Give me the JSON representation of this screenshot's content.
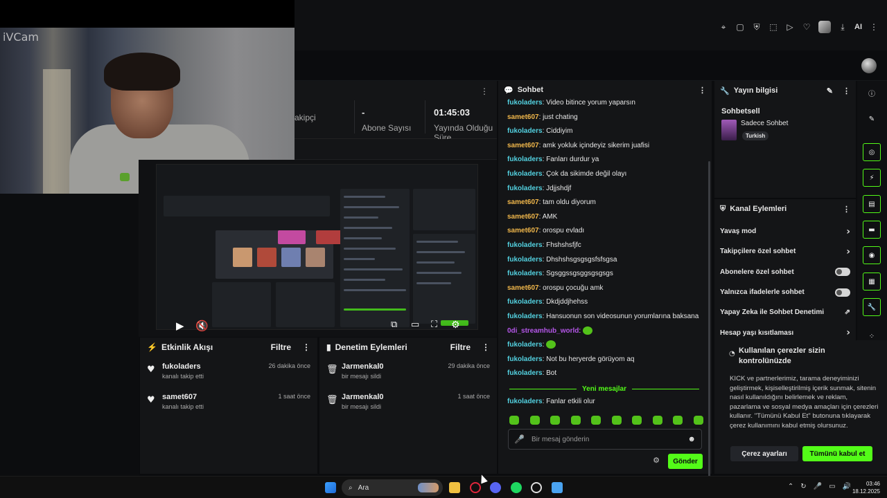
{
  "webcam": {
    "label": "iVCam"
  },
  "browser": {
    "ai_label": "AI"
  },
  "stats": {
    "items": [
      {
        "value": "",
        "label": "akipçi"
      },
      {
        "value": "-",
        "label": "Abone Sayısı"
      },
      {
        "value": "01:45:03",
        "label": "Yayında Olduğu Süre"
      }
    ]
  },
  "activity_feed": {
    "title": "Etkinlik Akışı",
    "filter": "Filtre",
    "items": [
      {
        "name": "fukoladers",
        "sub": "kanalı takip etti",
        "time": "26 dakika önce"
      },
      {
        "name": "samet607",
        "sub": "kanalı takip etti",
        "time": "1 saat önce"
      }
    ]
  },
  "moderation": {
    "title": "Denetim Eylemleri",
    "filter": "Filtre",
    "items": [
      {
        "name": "Jarmenkal0",
        "sub": "bir mesajı sildi",
        "time": "29 dakika önce"
      },
      {
        "name": "Jarmenkal0",
        "sub": "bir mesajı sildi",
        "time": "1 saat önce"
      }
    ]
  },
  "chat": {
    "title": "Sohbet",
    "messages": [
      {
        "user": "fukoladers",
        "color": "#53d1e0",
        "text": "Video bitince yorum yaparsın"
      },
      {
        "user": "samet607",
        "color": "#f2b84b",
        "text": "just chating"
      },
      {
        "user": "fukoladers",
        "color": "#53d1e0",
        "text": "Ciddiyim"
      },
      {
        "user": "samet607",
        "color": "#f2b84b",
        "text": "amk yokluk içindeyiz sikerim juafisi"
      },
      {
        "user": "fukoladers",
        "color": "#53d1e0",
        "text": "Fanları durdur ya"
      },
      {
        "user": "fukoladers",
        "color": "#53d1e0",
        "text": "Çok da sikimde değil olayı"
      },
      {
        "user": "fukoladers",
        "color": "#53d1e0",
        "text": "Jdjjshdjf"
      },
      {
        "user": "samet607",
        "color": "#f2b84b",
        "text": "tam oldu diyorum"
      },
      {
        "user": "samet607",
        "color": "#f2b84b",
        "text": "AMK"
      },
      {
        "user": "samet607",
        "color": "#f2b84b",
        "text": "orospu evladı"
      },
      {
        "user": "fukoladers",
        "color": "#53d1e0",
        "text": "Fhshshsfjfc"
      },
      {
        "user": "fukoladers",
        "color": "#53d1e0",
        "text": "Dhshshsgsgsgsfsfsgsa"
      },
      {
        "user": "fukoladers",
        "color": "#53d1e0",
        "text": "Sgsggssgsggsgsgsgs"
      },
      {
        "user": "samet607",
        "color": "#f2b84b",
        "text": "orospu çocuğu amk"
      },
      {
        "user": "fukoladers",
        "color": "#53d1e0",
        "text": "Dkdjddjhehss"
      },
      {
        "user": "fukoladers",
        "color": "#53d1e0",
        "text": "Hansuonun son videosunun yorumlarına baksana"
      },
      {
        "user": "0di_streamhub_world",
        "color": "#b456e8",
        "text": "",
        "emote": true
      },
      {
        "user": "fukoladers",
        "color": "#53d1e0",
        "text": "",
        "emote": true
      },
      {
        "user": "fukoladers",
        "color": "#53d1e0",
        "text": "Not bu heryerde görüyom aq"
      },
      {
        "user": "fukoladers",
        "color": "#53d1e0",
        "text": "Bot"
      }
    ],
    "new_messages_label": "Yeni mesajlar",
    "last_message": {
      "user": "fukoladers",
      "color": "#53d1e0",
      "text": "Fanlar etkili olur"
    },
    "input_placeholder": "Bir mesaj gönderin",
    "send_label": "Gönder"
  },
  "stream_info": {
    "title": "Yayın bilgisi",
    "category": "Sohbetsell",
    "category_title": "Sadece Sohbet",
    "language": "Turkish"
  },
  "channel_actions": {
    "title": "Kanal Eylemleri",
    "items": [
      {
        "label": "Yavaş mod",
        "control": "chevron"
      },
      {
        "label": "Takipçilere özel sohbet",
        "control": "chevron"
      },
      {
        "label": "Abonelere özel sohbet",
        "control": "toggle"
      },
      {
        "label": "Yalnızca ifadelerle sohbet",
        "control": "toggle"
      },
      {
        "label": "Yapay Zeka ile Sohbet Denetimi",
        "control": "external"
      },
      {
        "label": "Hesap yaşı kısıtlaması",
        "control": "chevron"
      }
    ]
  },
  "cookie": {
    "title": "Kullanılan çerezler sizin kontrolünüzde",
    "body": "KICK ve partnerlerimiz, tarama deneyiminizi geliştirmek, kişiselleştirilmiş içerik sunmak, sitenin nasıl kullanıldığını belirlemek ve reklam, pazarlama ve sosyal medya amaçları için çerezleri kullanır. \"Tümünü Kabul Et\" butonuna tıklayarak çerez kullanımını kabul etmiş olursunuz.",
    "settings_label": "Çerez ayarları",
    "accept_label": "Tümünü kabul et"
  },
  "taskbar": {
    "search_placeholder": "Ara",
    "time": "03:46",
    "date": "18.12.2025"
  },
  "colors": {
    "accent": "#53fc18",
    "panel": "#141517"
  }
}
